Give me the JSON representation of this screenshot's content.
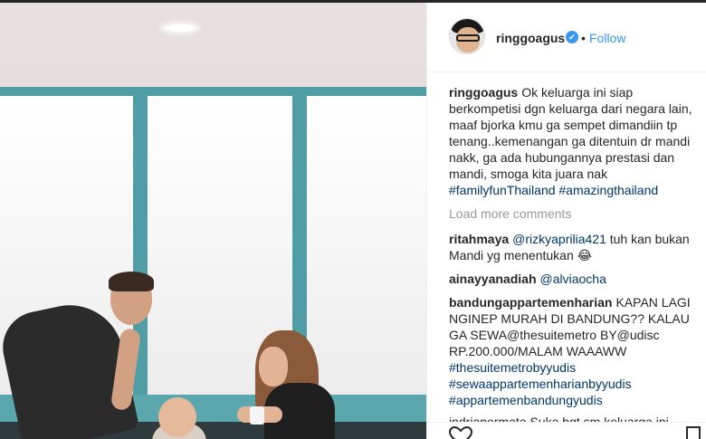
{
  "post": {
    "author": "ringgoagus",
    "verified_badge": "✔",
    "separator": "•",
    "follow_label": "Follow",
    "caption": {
      "user": "ringgoagus",
      "text": "Ok keluarga ini siap berkompetisi dgn keluarga dari negara lain, maaf bjorka kmu ga sempet dimandiin tp tenang..kemenangan ga ditentuin dr mandi nakk, ga ada hubungannya prestasi dan mandi, smoga kita juara nak",
      "hashtags": "#familyfunThailand #amazingthailand"
    },
    "load_more_label": "Load more comments",
    "comments": [
      {
        "user": "ritahmaya",
        "mention": "@rizkyaprilia421",
        "text": " tuh kan bukan Mandi yg menentukan 😂",
        "tail": ""
      },
      {
        "user": "ainayyanadiah",
        "mention": "@alviaocha",
        "text": "",
        "tail": ""
      },
      {
        "user": "bandungappartemenharian",
        "mention": "",
        "text": "KAPAN LAGI NGINEP MURAH DI BANDUNG?? KALAU GA SEWA@thesuitemetro BY@udisc RP.200.000/MALAM WAAAWW",
        "tail": "#thesuitemetrobyyudis #sewaappartemenharianbyyudis #appartemenbandungyudis"
      }
    ],
    "partial_comment": "indriapermata Suka bgt sm keluarga ini",
    "icons": {
      "like": "heart-icon",
      "save": "bookmark-icon"
    }
  },
  "colors": {
    "link": "#3897f0",
    "hashtag": "#003569",
    "muted": "#999999",
    "window_frame": "#4f9ea6"
  }
}
